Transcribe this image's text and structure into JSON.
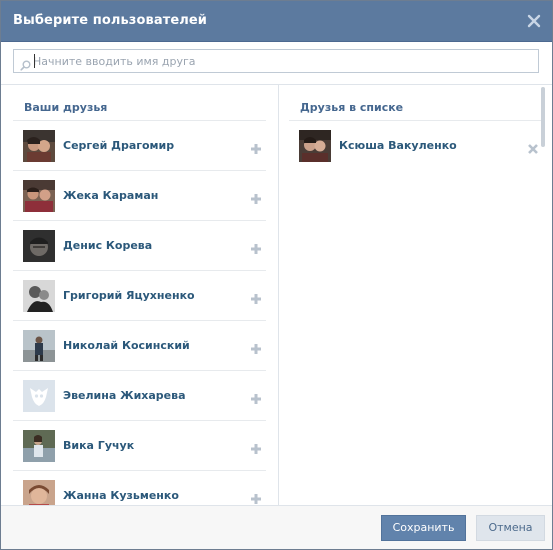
{
  "dialog": {
    "title": "Выберите пользователей",
    "close_icon": "close-icon"
  },
  "search": {
    "placeholder": "Начните вводить имя друга",
    "value": "",
    "icon": "search-icon"
  },
  "friends": {
    "header": "Ваши друзья",
    "action_icon": "plus-icon",
    "items": [
      {
        "name": "Сергей Драгомир"
      },
      {
        "name": "Жека Караман"
      },
      {
        "name": "Денис Корева"
      },
      {
        "name": "Григорий Яцухненко"
      },
      {
        "name": "Николай Косинский"
      },
      {
        "name": "Эвелина Жихарева"
      },
      {
        "name": "Вика Гучук"
      },
      {
        "name": "Жанна Кузьменко"
      }
    ]
  },
  "selected": {
    "header": "Друзья в списке",
    "action_icon": "remove-icon",
    "items": [
      {
        "name": "Ксюша Вакуленко"
      }
    ]
  },
  "footer": {
    "save_label": "Сохранить",
    "cancel_label": "Отмена"
  },
  "colors": {
    "titlebar": "#5c7a9f",
    "link": "#2b587a",
    "header": "#45678f",
    "primary_button": "#6183ac",
    "secondary_button": "#dfe5ec"
  }
}
